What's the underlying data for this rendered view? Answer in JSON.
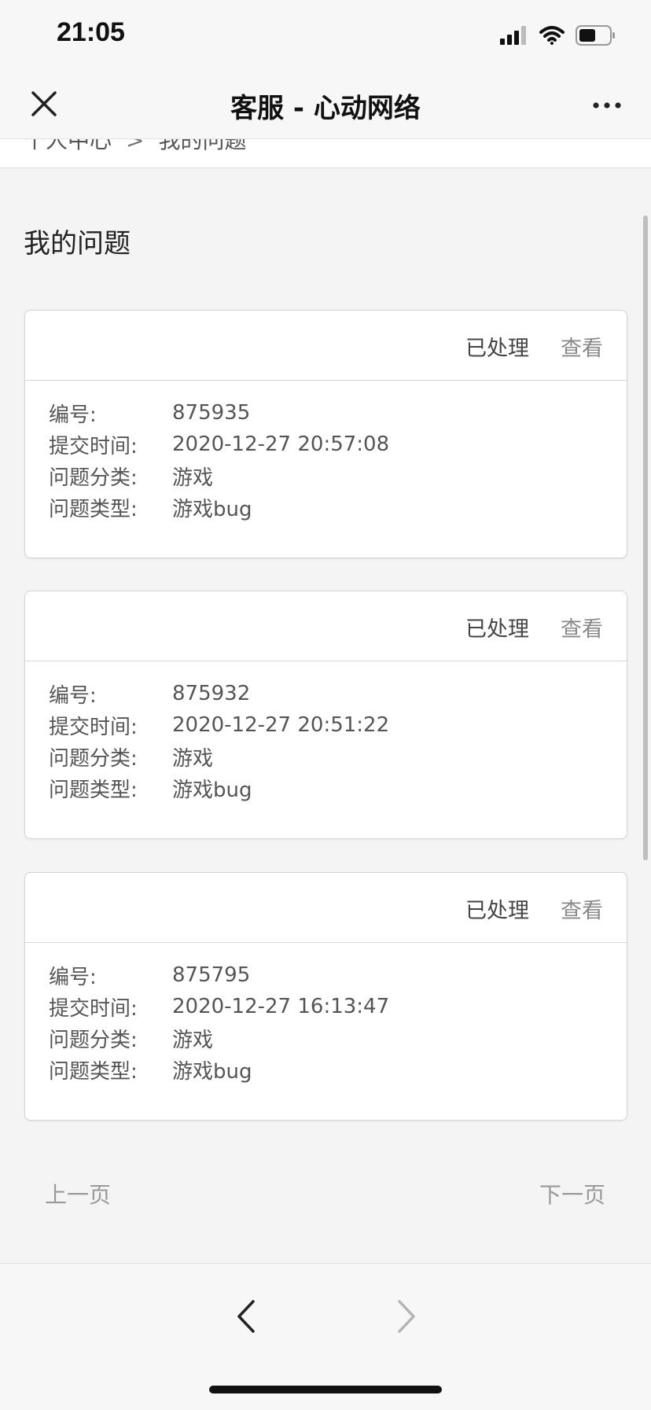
{
  "status_bar": {
    "time": "21:05"
  },
  "nav": {
    "title": "客服 - 心动网络"
  },
  "breadcrumb": {
    "items": [
      "个人中心",
      "我的问题"
    ],
    "separator": ">"
  },
  "page": {
    "heading": "我的问题"
  },
  "labels": {
    "id": "编号:",
    "submit_time": "提交时间:",
    "category": "问题分类:",
    "type": "问题类型:"
  },
  "tickets": [
    {
      "status": "已处理",
      "action": "查看",
      "id": "875935",
      "submit_time": "2020-12-27 20:57:08",
      "category": "游戏",
      "type": "游戏bug"
    },
    {
      "status": "已处理",
      "action": "查看",
      "id": "875932",
      "submit_time": "2020-12-27 20:51:22",
      "category": "游戏",
      "type": "游戏bug"
    },
    {
      "status": "已处理",
      "action": "查看",
      "id": "875795",
      "submit_time": "2020-12-27 16:13:47",
      "category": "游戏",
      "type": "游戏bug"
    }
  ],
  "pager": {
    "prev": "上一页",
    "next": "下一页"
  },
  "icons": {
    "close": "close-icon",
    "more": "more-icon",
    "back": "chevron-left-icon",
    "forward": "chevron-right-icon",
    "signal": "signal-icon",
    "wifi": "wifi-icon",
    "battery": "battery-icon"
  },
  "colors": {
    "background": "#f4f4f4",
    "card": "#ffffff",
    "muted_text": "#999999"
  }
}
